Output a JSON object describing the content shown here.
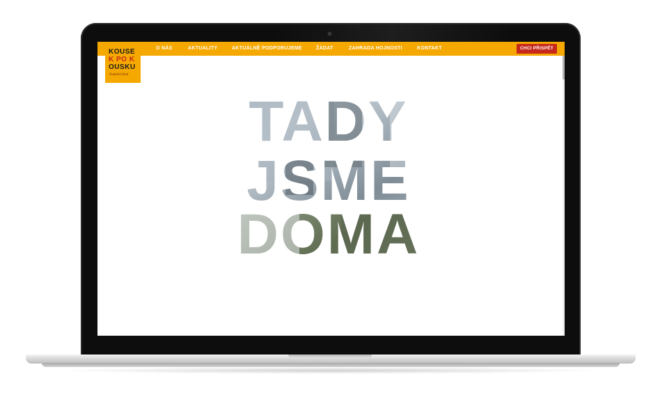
{
  "logo": {
    "line1": "KOUSE",
    "line2": "K PO K",
    "line3": "OUSKU",
    "subtitle": "Nadační fond"
  },
  "nav": {
    "items": [
      {
        "label": "O NÁS"
      },
      {
        "label": "AKTUALITY"
      },
      {
        "label": "AKTUÁLNĚ PODPORUJEME"
      },
      {
        "label": "ŽÁDAT"
      },
      {
        "label": "ZAHRADA HOJNOSTI"
      },
      {
        "label": "KONTAKT"
      }
    ],
    "donate_label": "CHCI PŘISPĚT"
  },
  "hero": {
    "line1": "TADY",
    "line2": "JSME",
    "line3": "DOMA"
  },
  "colors": {
    "brand_orange": "#f5a800",
    "accent_red": "#c6281b"
  }
}
